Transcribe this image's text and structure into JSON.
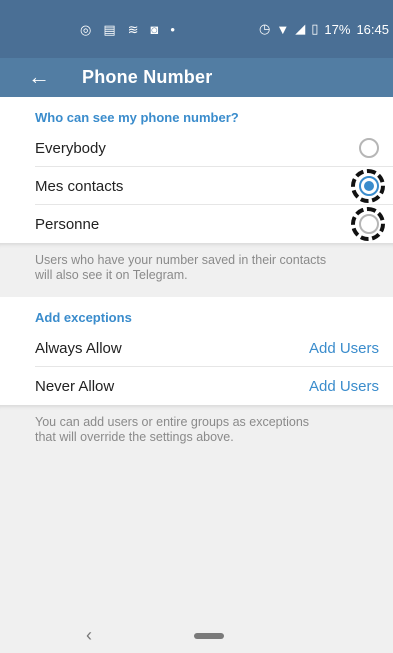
{
  "status_bar": {
    "left_icons": [
      "whatsapp-icon",
      "message-icon",
      "sync-icon",
      "instagram-icon",
      "dot-icon"
    ],
    "right_icons": [
      "alarm-icon",
      "wifi-icon",
      "signal-icon",
      "battery-icon"
    ],
    "battery": "17%",
    "time": "16:45"
  },
  "app_bar": {
    "title": "Phone Number"
  },
  "visibility": {
    "header": "Who can see my phone number?",
    "options": [
      {
        "label": "Everybody",
        "selected": false
      },
      {
        "label": "Mes contacts",
        "selected": true
      },
      {
        "label": "Personne",
        "selected": false
      }
    ],
    "info": "Users who have your number saved in their contacts will also see it on Telegram."
  },
  "exceptions": {
    "header": "Add exceptions",
    "rows": [
      {
        "label": "Always Allow",
        "action": "Add Users"
      },
      {
        "label": "Never Allow",
        "action": "Add Users"
      }
    ],
    "info": "You can add users or entire groups as exceptions that will override the settings above."
  },
  "colors": {
    "status_bar": "#4a6f95",
    "app_bar": "#527da3",
    "accent": "#3a8ccc"
  }
}
